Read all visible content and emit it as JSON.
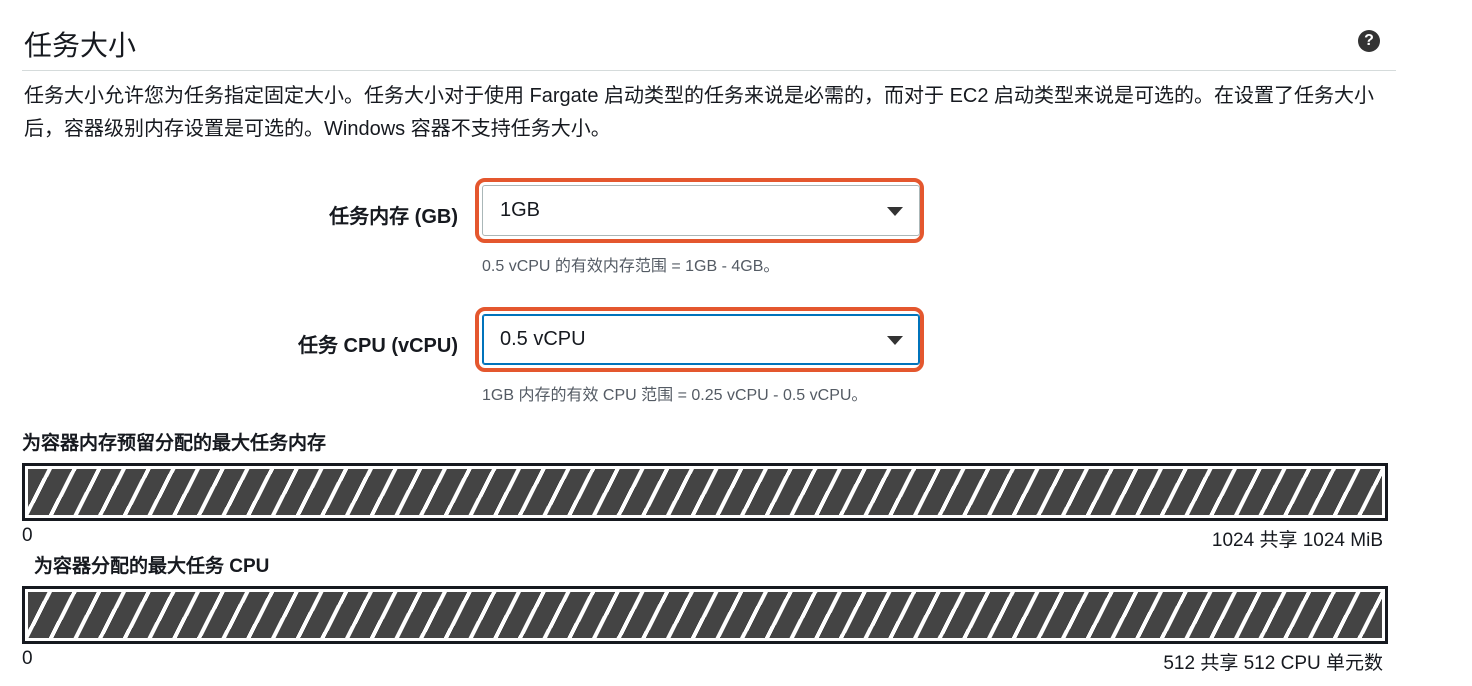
{
  "section": {
    "title": "任务大小",
    "description": "任务大小允许您为任务指定固定大小。任务大小对于使用 Fargate 启动类型的任务来说是必需的，而对于 EC2 启动类型来说是可选的。在设置了任务大小后，容器级别内存设置是可选的。Windows 容器不支持任务大小。"
  },
  "memory": {
    "label": "任务内存 (GB)",
    "value": "1GB",
    "hint": "0.5 vCPU 的有效内存范围 = 1GB - 4GB。"
  },
  "cpu": {
    "label": "任务 CPU (vCPU)",
    "value": "0.5 vCPU",
    "hint": "1GB 内存的有效 CPU 范围 = 0.25 vCPU - 0.5 vCPU。"
  },
  "memory_bar": {
    "title": "为容器内存预留分配的最大任务内存",
    "min": "0",
    "max": "1024 共享 1024 MiB"
  },
  "cpu_bar": {
    "title": "为容器分配的最大任务 CPU",
    "min": "0",
    "max": "512 共享 512 CPU 单元数"
  },
  "icons": {
    "help": "help-icon"
  },
  "colors": {
    "highlight": "#e4572e",
    "focus": "#0073bb"
  }
}
